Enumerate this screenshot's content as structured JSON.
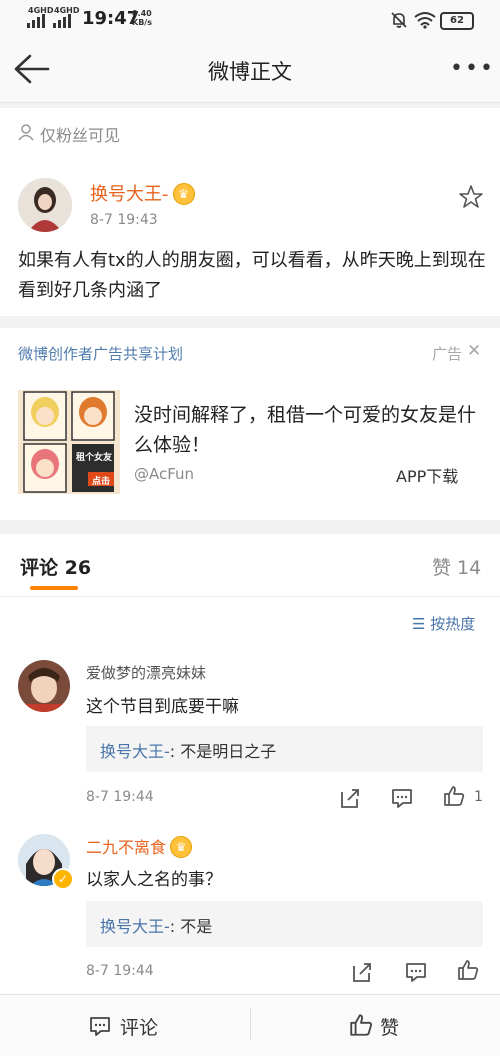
{
  "status": {
    "signal1": "4GHD",
    "signal2": "4GHD",
    "time": "19:47",
    "speed_value": "0.40",
    "speed_unit": "KB/s",
    "battery": "62"
  },
  "nav": {
    "title": "微博正文"
  },
  "visibility": "仅粉丝可见",
  "post": {
    "author": "换号大王-",
    "time": "8-7 19:43",
    "content": "如果有人有tx的人的朋友圈，可以看看，从昨天晚上到现在看到好几条内涵了"
  },
  "ad": {
    "source": "微博创作者广告共享计划",
    "label": "广告",
    "text": "没时间解释了，租借一个可爱的女友是什么体验！",
    "advertiser": "@AcFun",
    "button": "APP下载",
    "thumb_caption1": "租个女友",
    "thumb_caption2": "点击"
  },
  "comments_header": {
    "tab": "评论 26",
    "likes": "赞 14",
    "sort": "按热度"
  },
  "comments": [
    {
      "name": "爱做梦的漂亮妹妹",
      "text": "这个节目到底要干嘛",
      "reply_author": "换号大王-",
      "reply_text": ": 不是明日之子",
      "time": "8-7 19:44",
      "like_count": "1"
    },
    {
      "name": "二九不离食",
      "text": "以家人之名的事？",
      "reply_author": "换号大王-",
      "reply_text": ": 不是",
      "time": "8-7 19:44",
      "like_count": ""
    }
  ],
  "bottom": {
    "comment": "评论",
    "like": "赞"
  },
  "colors": {
    "accent": "#ff8200",
    "link": "#4a75aa",
    "username": "#e8631d"
  }
}
